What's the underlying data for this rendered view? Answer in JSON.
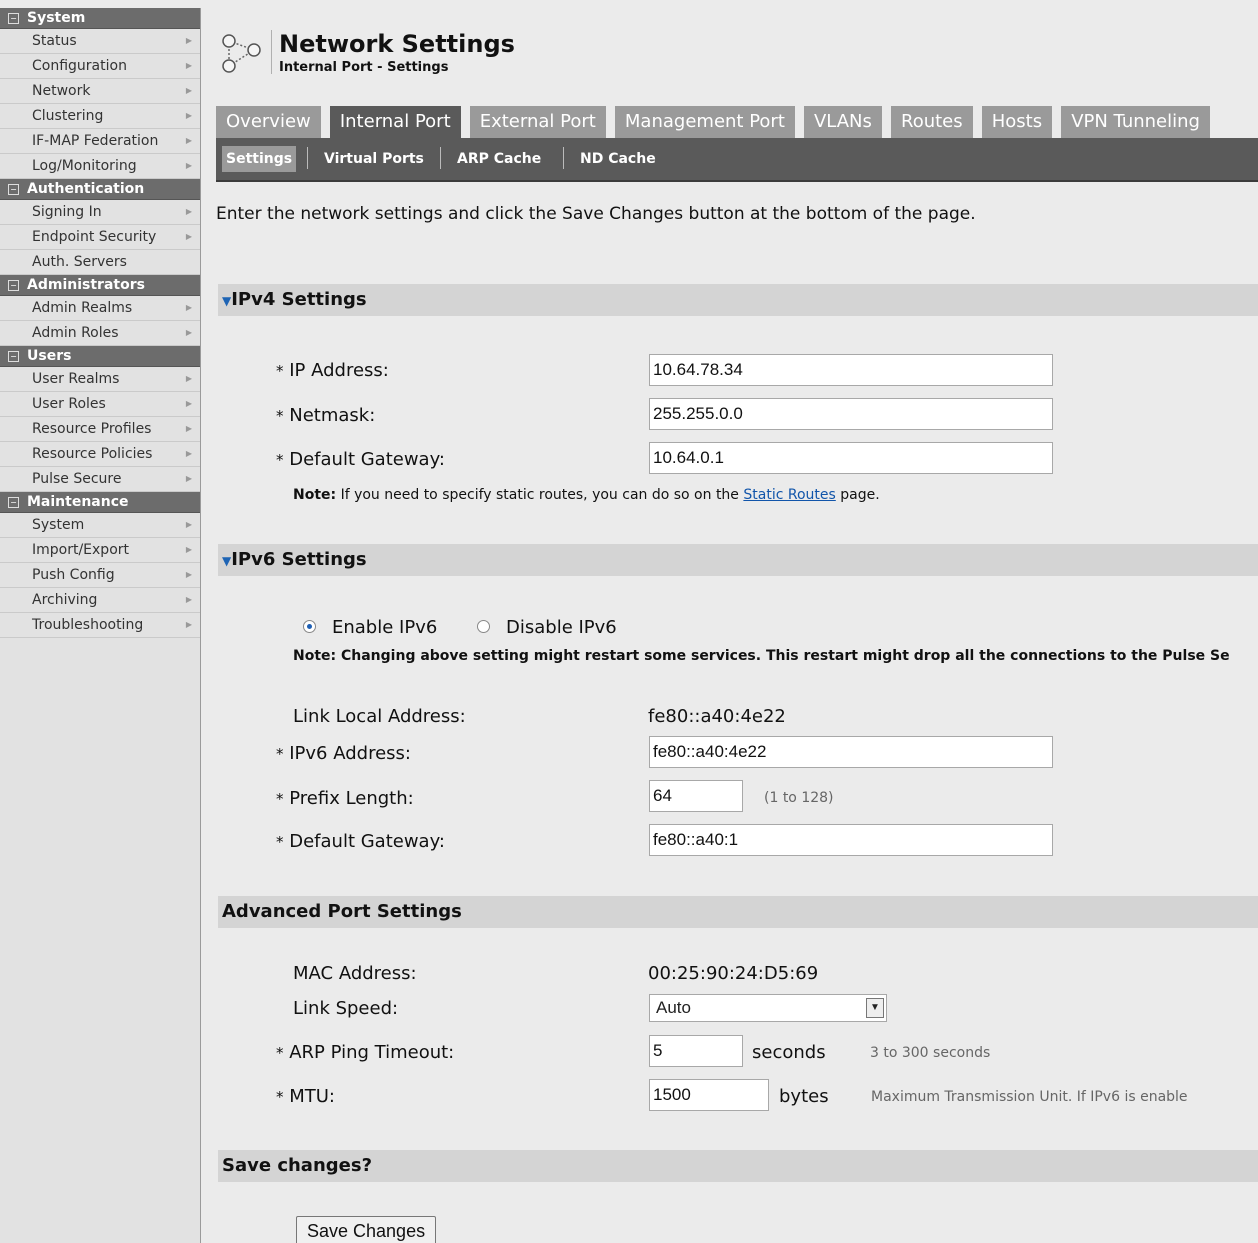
{
  "sidebar": {
    "groups": [
      {
        "title": "System",
        "items": [
          "Status",
          "Configuration",
          "Network",
          "Clustering",
          "IF-MAP Federation",
          "Log/Monitoring"
        ]
      },
      {
        "title": "Authentication",
        "items": [
          "Signing In",
          "Endpoint Security",
          "Auth. Servers"
        ]
      },
      {
        "title": "Administrators",
        "items": [
          "Admin Realms",
          "Admin Roles"
        ]
      },
      {
        "title": "Users",
        "items": [
          "User Realms",
          "User Roles",
          "Resource Profiles",
          "Resource Policies",
          "Pulse Secure"
        ]
      },
      {
        "title": "Maintenance",
        "items": [
          "System",
          "Import/Export",
          "Push Config",
          "Archiving",
          "Troubleshooting"
        ]
      }
    ],
    "collapse_glyph": "−",
    "arrow_glyph": "▶"
  },
  "header": {
    "title": "Network Settings",
    "subtitle": "Internal Port - Settings",
    "icon": "network-nodes-icon"
  },
  "tabs": [
    "Overview",
    "Internal Port",
    "External Port",
    "Management Port",
    "VLANs",
    "Routes",
    "Hosts",
    "VPN Tunneling"
  ],
  "active_tab": "Internal Port",
  "subtabs": [
    "Settings",
    "Virtual Ports",
    "ARP Cache",
    "ND Cache"
  ],
  "active_subtab": "Settings",
  "intro": "Enter the network settings and click the Save Changes button at the bottom of the page.",
  "required_mark": "*",
  "ipv4": {
    "heading": "IPv4 Settings",
    "ip_label": "IP Address:",
    "ip_value": "10.64.78.34",
    "netmask_label": "Netmask:",
    "netmask_value": "255.255.0.0",
    "gateway_label": "Default Gateway:",
    "gateway_value": "10.64.0.1",
    "note_bold": "Note:",
    "note_text": " If you need to specify static routes, you can do so on the ",
    "note_link": "Static Routes",
    "note_after": " page."
  },
  "ipv6": {
    "heading": "IPv6 Settings",
    "enable_label": "Enable IPv6",
    "disable_label": "Disable IPv6",
    "enabled": true,
    "note": "Note: Changing above setting might restart some services. This restart might drop all the connections to the Pulse Se",
    "link_local_label": "Link Local Address:",
    "link_local_value": "fe80::a40:4e22",
    "address_label": "IPv6 Address:",
    "address_value": "fe80::a40:4e22",
    "prefix_label": "Prefix Length:",
    "prefix_value": "64",
    "prefix_hint": "(1 to 128)",
    "gateway_label": "Default Gateway:",
    "gateway_value": "fe80::a40:1"
  },
  "advanced": {
    "heading": "Advanced Port Settings",
    "mac_label": "MAC Address:",
    "mac_value": "00:25:90:24:D5:69",
    "speed_label": "Link Speed:",
    "speed_value": "Auto",
    "arp_label": "ARP Ping Timeout:",
    "arp_value": "5",
    "arp_unit": "seconds",
    "arp_hint": "3 to 300 seconds",
    "mtu_label": "MTU:",
    "mtu_value": "1500",
    "mtu_unit": "bytes",
    "mtu_hint": "Maximum Transmission Unit. If IPv6 is enable"
  },
  "save": {
    "heading": "Save changes?",
    "button": "Save Changes"
  },
  "colors": {
    "tab_active": "#5a5a5a",
    "tab_inactive": "#9a9a9a",
    "section_bg": "#d4d4d4",
    "accent": "#1e64b4"
  }
}
